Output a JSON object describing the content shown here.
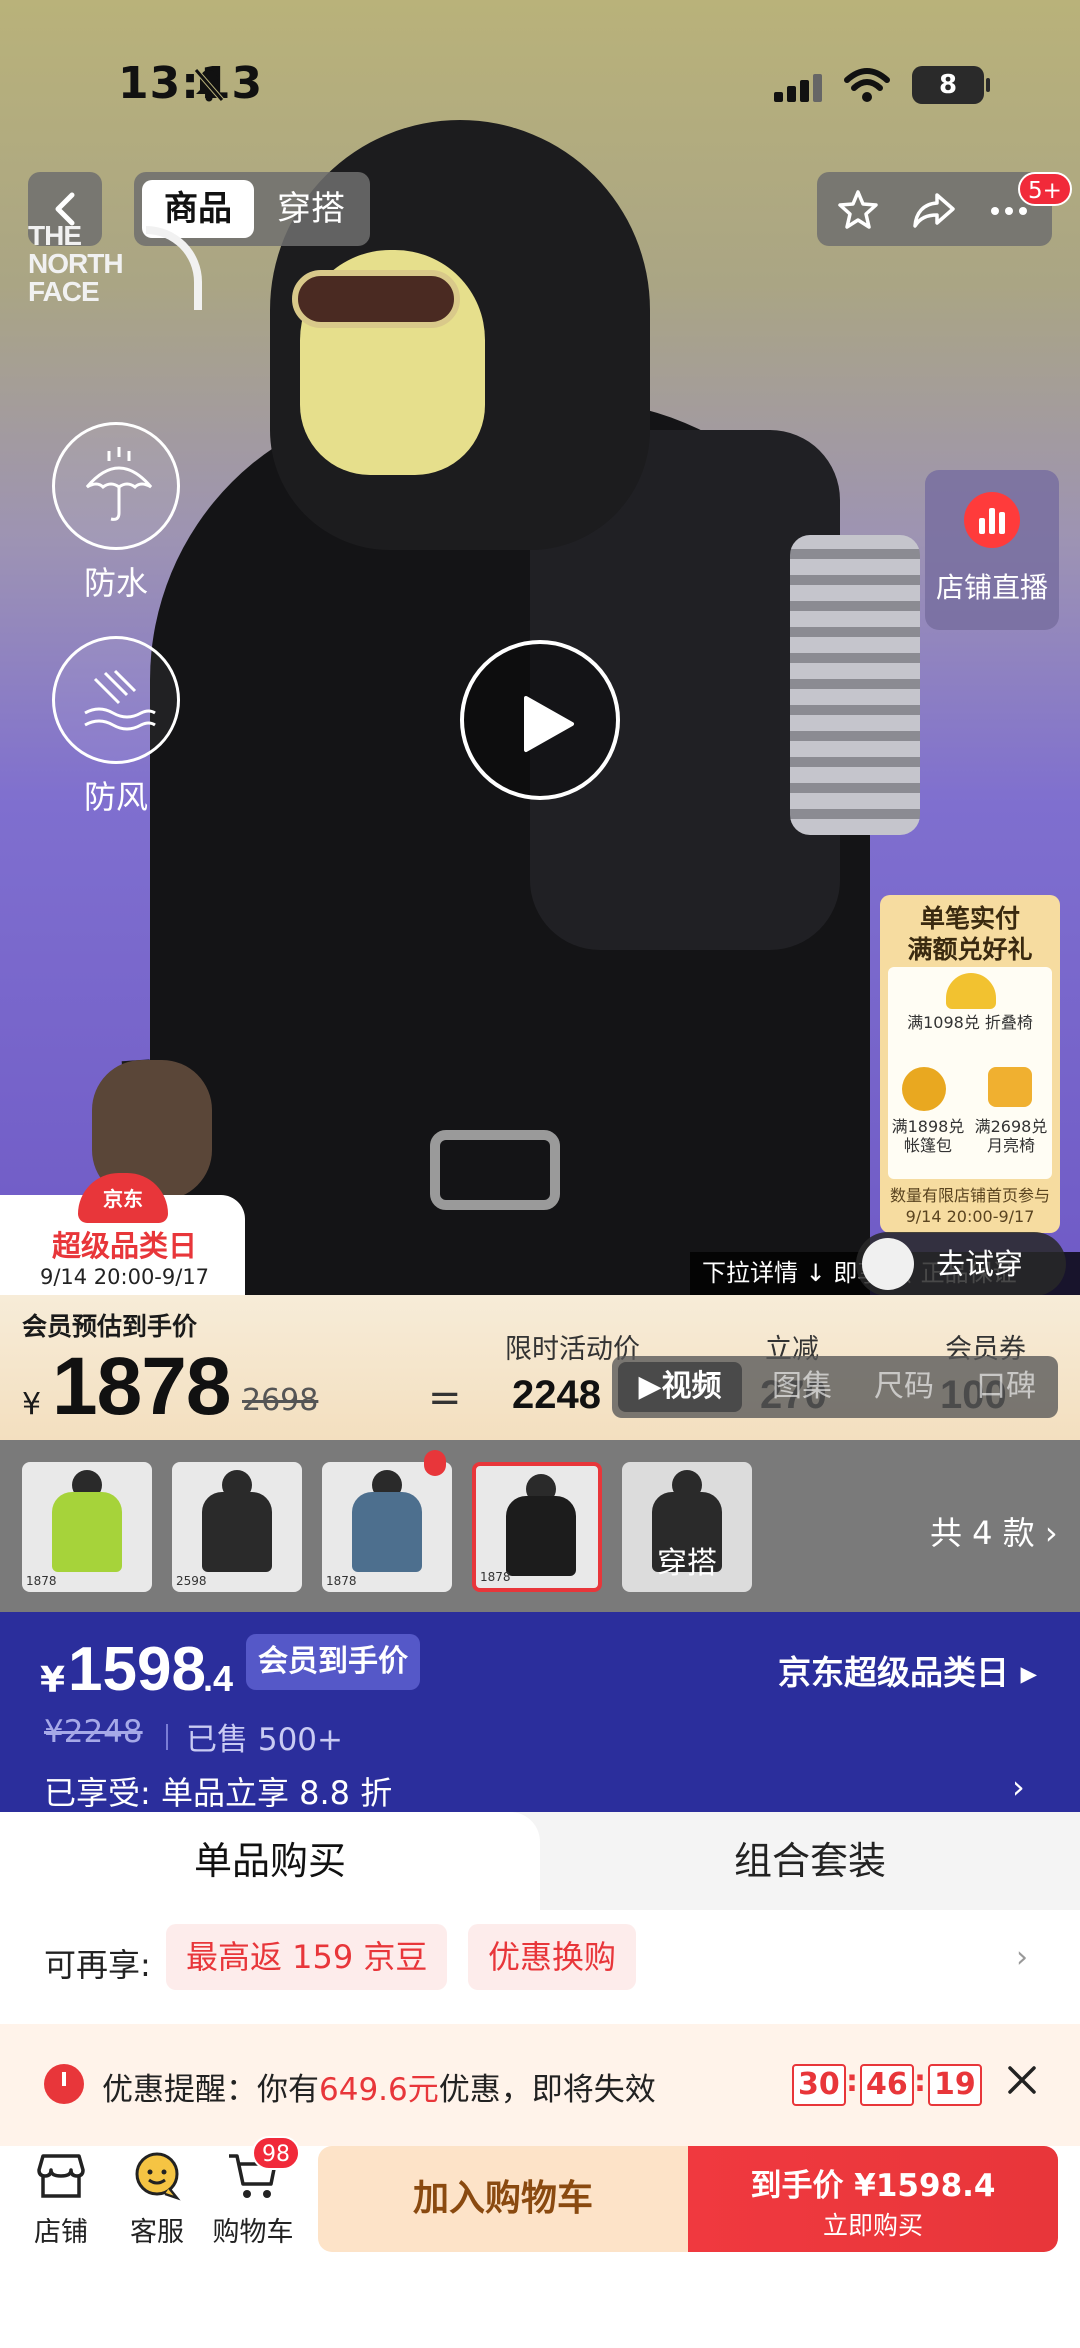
{
  "status_bar": {
    "time": "13:13",
    "battery": "8"
  },
  "header": {
    "tabs": [
      "商品",
      "穿搭"
    ],
    "more_badge": "5+"
  },
  "hero": {
    "brand_lines": [
      "THE",
      "NORTH",
      "FACE"
    ],
    "features": [
      "防水",
      "防风"
    ],
    "live_label": "店铺直播",
    "promo_card": {
      "title_line1": "单笔实付",
      "title_line2": "满额兑好礼",
      "gift1": "满1098兑 折叠椅",
      "gift2": "满1898兑 帐篷包",
      "gift3": "满2698兑 月亮椅",
      "footer_line1": "数量有限店铺首页参与",
      "footer_line2": "9/14 20:00-9/17"
    },
    "event": {
      "seal": "京东",
      "name": "超级品类日",
      "dates": "9/14 20:00-9/17"
    },
    "pulldown_text": "下拉详情 ↓ 即享 会 正品保证",
    "tryon_label": "去试穿"
  },
  "formula": {
    "label": "会员预估到手价",
    "yen": "¥",
    "price": "1878",
    "original": "2698",
    "equals": "=",
    "promo_head": "限时活动价",
    "promo_value": "2248",
    "discount_head": "立减",
    "discount_value": "270",
    "coupon_head": "会员券",
    "coupon_value": "100"
  },
  "media_tabs": [
    "▶视频",
    "图集",
    "尺码",
    "口碑"
  ],
  "variants": {
    "items": [
      {
        "label": "1878",
        "color": "#a6d33a"
      },
      {
        "label": "2598",
        "color": "#2a2a2a"
      },
      {
        "label": "1878",
        "color": "#4d6f8e"
      },
      {
        "label": "1878",
        "color": "#1c1c1c"
      },
      {
        "label": "",
        "color": "#2a2a2a"
      }
    ],
    "outfit_label": "穿搭",
    "count": "共 4 款"
  },
  "price_panel": {
    "yen": "¥",
    "price": "1598",
    "decimal": ".4",
    "tag": "会员到手价",
    "original": "¥2248",
    "sold": "已售 500+",
    "promo": "京东超级品类日",
    "enjoyed": "已享受: 单品立享 8.8 折"
  },
  "purchase_tabs": {
    "single": "单品购买",
    "combo": "组合套装"
  },
  "extra": {
    "label": "可再享:",
    "chips": [
      "最高返 159 京豆",
      "优惠换购"
    ]
  },
  "reminder": {
    "prefix": "优惠提醒：你有",
    "amount": "649.6元",
    "suffix": "优惠，即将失效",
    "countdown": [
      "30",
      "46",
      "19"
    ]
  },
  "bottom_bar": {
    "store": "店铺",
    "service": "客服",
    "cart": "购物车",
    "cart_badge": "98",
    "add_cart": "加入购物车",
    "buy_line1": "到手价 ¥1598.4",
    "buy_line2": "立即购买"
  },
  "colors": {
    "accent": "#e8363a",
    "price_panel": "#2b2e9c"
  }
}
